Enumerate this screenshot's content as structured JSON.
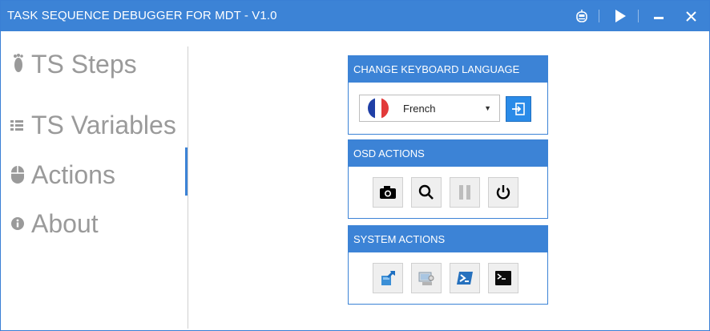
{
  "window": {
    "title": "TASK SEQUENCE DEBUGGER FOR MDT - V1.0",
    "accent_color": "#3c83d6",
    "controls": [
      "robot-icon",
      "play-icon",
      "minimize-icon",
      "close-icon"
    ]
  },
  "sidebar": {
    "items": [
      {
        "label": "TS Steps",
        "icon": "footprint-icon",
        "active": false
      },
      {
        "label": "TS Variables",
        "icon": "list-icon",
        "active": false
      },
      {
        "label": "Actions",
        "icon": "mouse-icon",
        "active": true
      },
      {
        "label": "About",
        "icon": "info-icon",
        "active": false
      }
    ]
  },
  "panels": {
    "keyboard": {
      "header": "CHANGE KEYBOARD LANGUAGE",
      "selected_language": "French",
      "flag_icon": "french-flag-icon",
      "apply_icon": "apply-arrow-icon"
    },
    "osd": {
      "header": "OSD ACTIONS",
      "buttons": [
        {
          "icon": "camera-icon",
          "enabled": true
        },
        {
          "icon": "search-icon",
          "enabled": true
        },
        {
          "icon": "pause-icon",
          "enabled": false
        },
        {
          "icon": "power-icon",
          "enabled": true
        }
      ]
    },
    "system": {
      "header": "SYSTEM ACTIONS",
      "buttons": [
        {
          "icon": "installer-icon",
          "enabled": true
        },
        {
          "icon": "device-manager-icon",
          "enabled": true
        },
        {
          "icon": "powershell-icon",
          "enabled": true
        },
        {
          "icon": "command-prompt-icon",
          "enabled": true
        }
      ]
    }
  }
}
